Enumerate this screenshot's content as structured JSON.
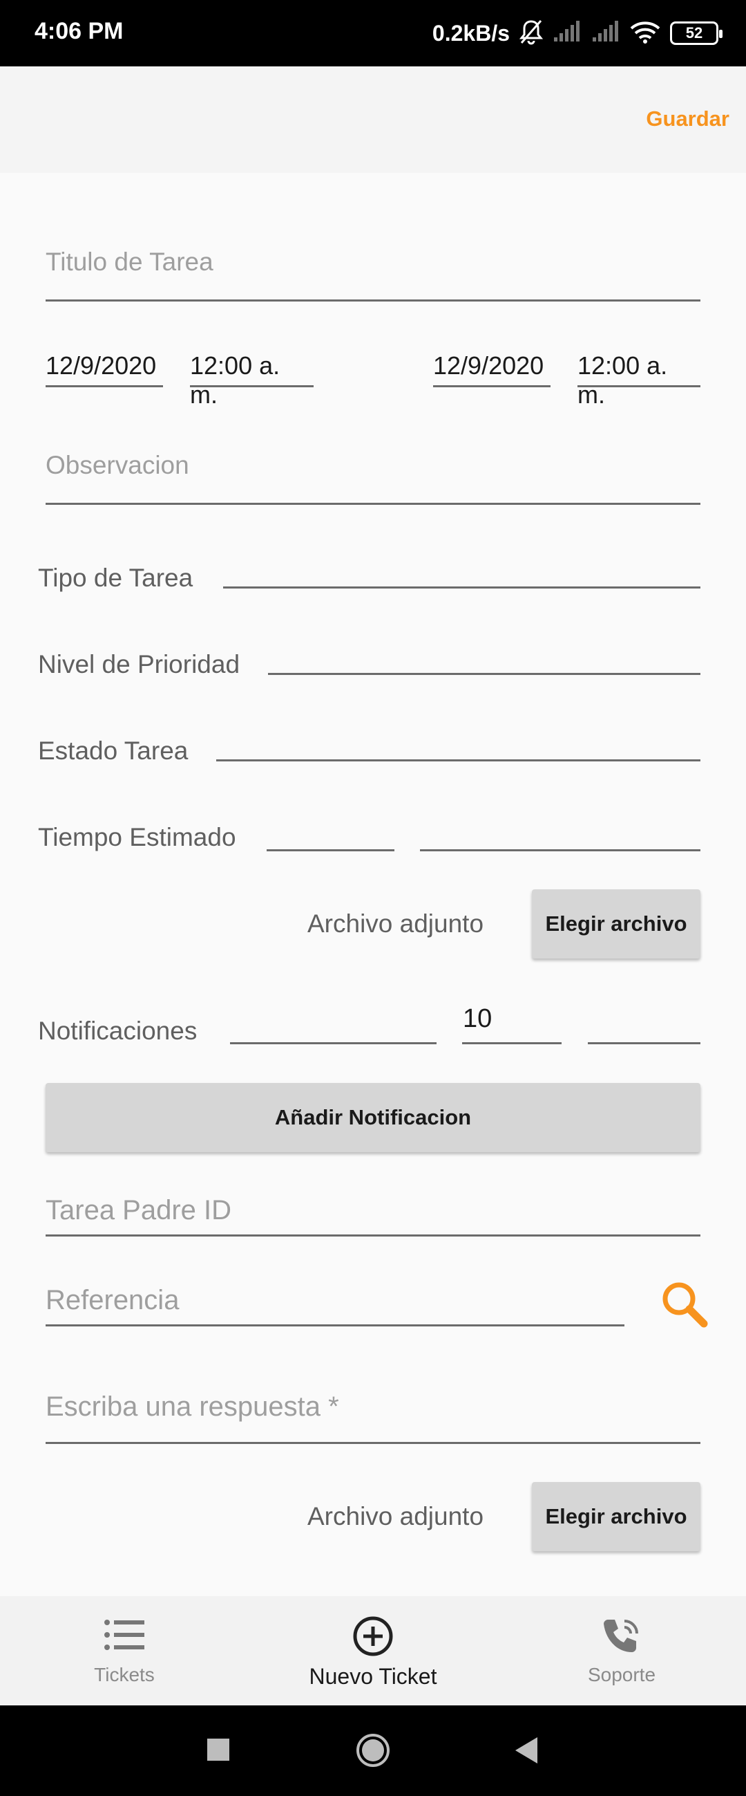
{
  "status_bar": {
    "time": "4:06 PM",
    "speed": "0.2kB/s",
    "battery": "52"
  },
  "appbar": {
    "save_label": "Guardar"
  },
  "form": {
    "titulo_placeholder": "Titulo de Tarea",
    "start_date": "12/9/2020",
    "start_time": "12:00 a. m.",
    "end_date": "12/9/2020",
    "end_time": "12:00 a. m.",
    "observacion_placeholder": "Observacion",
    "tipo_label": "Tipo de Tarea",
    "prioridad_label": "Nivel de Prioridad",
    "estado_label": "Estado Tarea",
    "tiempo_label": "Tiempo Estimado",
    "adjunto_label_1": "Archivo adjunto",
    "elegir_label_1": "Elegir archivo",
    "notificaciones_label": "Notificaciones",
    "notificaciones_value": "10",
    "add_notif_label": "Añadir Notificacion",
    "padre_placeholder": "Tarea Padre ID",
    "referencia_placeholder": "Referencia",
    "respuesta_placeholder": "Escriba una respuesta *",
    "adjunto_label_2": "Archivo adjunto",
    "elegir_label_2": "Elegir archivo"
  },
  "bottom_nav": {
    "items": [
      {
        "label": "Tickets",
        "icon": "list-icon"
      },
      {
        "label": "Nuevo Ticket",
        "icon": "add-circle-icon"
      },
      {
        "label": "Soporte",
        "icon": "phone-call-icon"
      }
    ]
  },
  "colors": {
    "accent": "#f7931e"
  }
}
